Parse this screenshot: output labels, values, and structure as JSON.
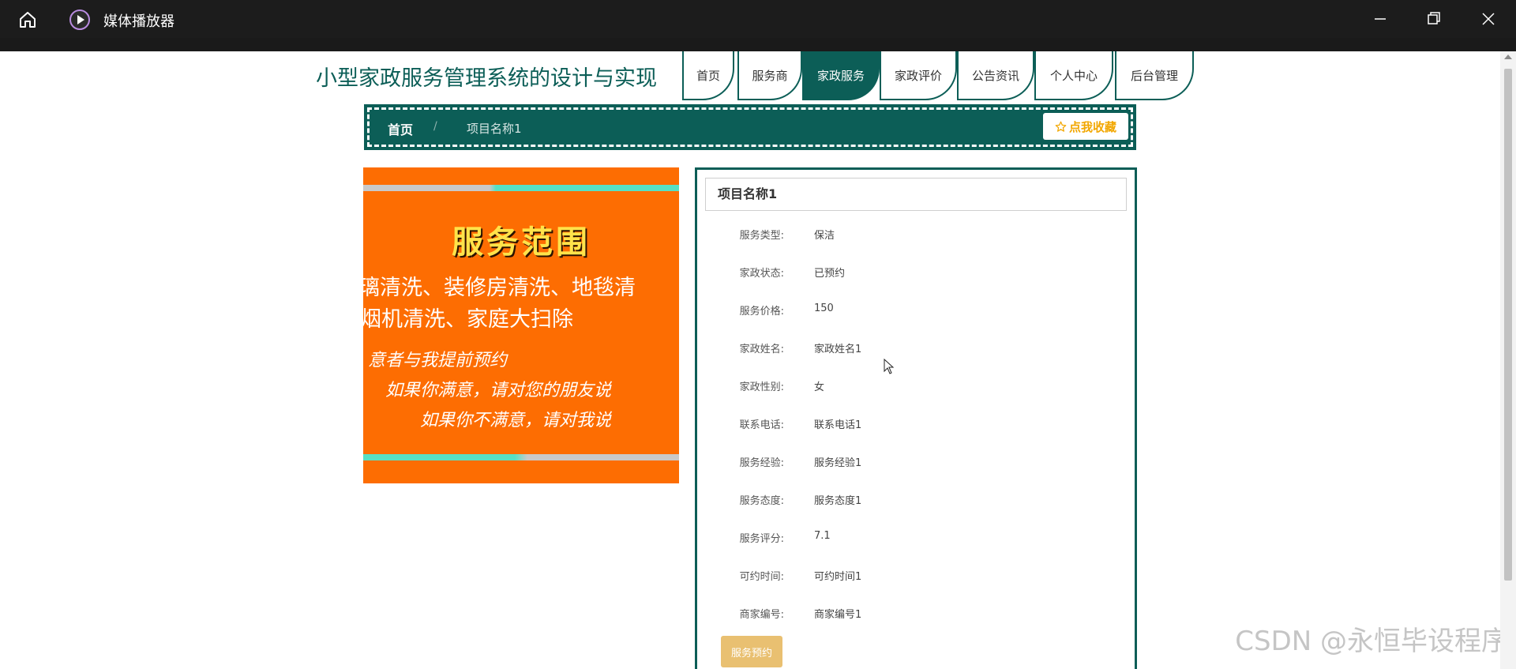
{
  "window": {
    "app_title": "媒体播放器"
  },
  "site": {
    "title": "小型家政服务管理系统的设计与实现"
  },
  "nav": {
    "items": [
      {
        "label": "首页"
      },
      {
        "label": "服务商"
      },
      {
        "label": "家政服务",
        "active": true
      },
      {
        "label": "家政评价"
      },
      {
        "label": "公告资讯"
      },
      {
        "label": "个人中心"
      },
      {
        "label": "后台管理"
      }
    ]
  },
  "breadcrumb": {
    "home": "首页",
    "separator": "/",
    "current": "项目名称1",
    "favorite_label": "点我收藏"
  },
  "image": {
    "title": "服务范围",
    "line1": "璃清洗、装修房清洗、地毯清",
    "line2": "烟机清洗、家庭大扫除",
    "line3": "意者与我提前预约",
    "line4": "如果你满意，请对您的朋友说",
    "line5": "如果你不满意，请对我说"
  },
  "detail": {
    "title": "项目名称1",
    "fields": [
      {
        "label": "服务类型:",
        "value": "保洁"
      },
      {
        "label": "家政状态:",
        "value": "已预约"
      },
      {
        "label": "服务价格:",
        "value": "150"
      },
      {
        "label": "家政姓名:",
        "value": "家政姓名1"
      },
      {
        "label": "家政性别:",
        "value": "女"
      },
      {
        "label": "联系电话:",
        "value": "联系电话1"
      },
      {
        "label": "服务经验:",
        "value": "服务经验1"
      },
      {
        "label": "服务态度:",
        "value": "服务态度1"
      },
      {
        "label": "服务评分:",
        "value": "7.1"
      },
      {
        "label": "可约时间:",
        "value": "可约时间1"
      },
      {
        "label": "商家编号:",
        "value": "商家编号1"
      }
    ],
    "book_button": "服务预约"
  },
  "watermark": "CSDN @永恒毕设程序",
  "colors": {
    "primary": "#0c5e57",
    "accent": "#f2a700",
    "button": "#e9c071",
    "image_bg": "#fd6d02"
  }
}
